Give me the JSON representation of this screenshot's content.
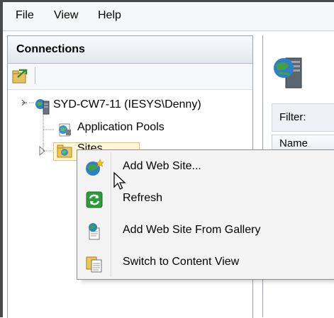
{
  "menubar": {
    "items": [
      "File",
      "View",
      "Help"
    ]
  },
  "connections": {
    "title": "Connections",
    "tree": {
      "server_label": "SYD-CW7-11 (IESYS\\Denny)",
      "app_pools_label": "Application Pools",
      "sites_label": "Sites"
    }
  },
  "content": {
    "filter_label": "Filter:",
    "name_column_label": "Name"
  },
  "context_menu": {
    "items": [
      {
        "label": "Add Web Site...",
        "icon": "globe-add-icon"
      },
      {
        "label": "Refresh",
        "icon": "refresh-icon"
      },
      {
        "label": "Add Web Site From Gallery",
        "icon": "gallery-icon"
      },
      {
        "label": "Switch to Content View",
        "icon": "content-view-icon"
      }
    ]
  }
}
